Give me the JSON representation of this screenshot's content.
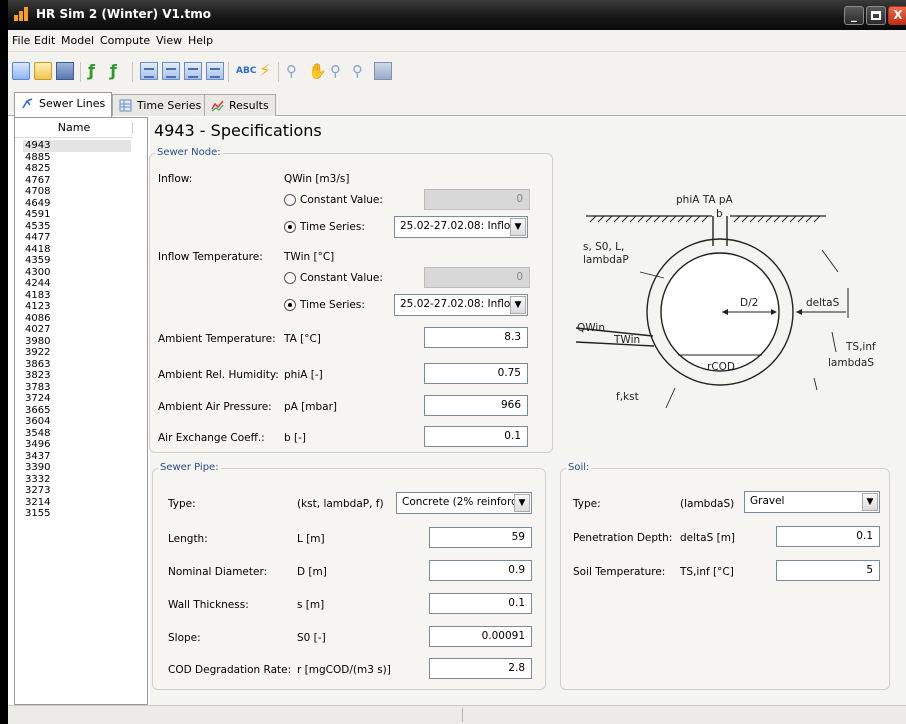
{
  "window": {
    "title": "HR Sim 2 (Winter) V1.tmo",
    "minimize": "_",
    "close": "X"
  },
  "menu": [
    "File",
    "Edit",
    "Model",
    "Compute",
    "View",
    "Help"
  ],
  "tabs": [
    {
      "label": "Sewer Lines",
      "icon": "sewer-lines-icon",
      "active": true
    },
    {
      "label": "Time Series",
      "icon": "table-icon",
      "active": false
    },
    {
      "label": "Results",
      "icon": "chart-icon",
      "active": false
    }
  ],
  "list": {
    "header": "Name",
    "selected": "4943",
    "items": [
      "4943",
      "4885",
      "4825",
      "4767",
      "4708",
      "4649",
      "4591",
      "4535",
      "4477",
      "4418",
      "4359",
      "4300",
      "4244",
      "4183",
      "4123",
      "4086",
      "4027",
      "3980",
      "3922",
      "3863",
      "3823",
      "3783",
      "3724",
      "3665",
      "3604",
      "3548",
      "3496",
      "3437",
      "3390",
      "3332",
      "3273",
      "3214",
      "3155"
    ]
  },
  "heading": "4943 - Specifications",
  "sewer_node": {
    "legend": "Sewer Node:",
    "inflow": {
      "label": "Inflow:",
      "symbol": "QWin [m3/s]",
      "constant_label": "Constant Value:",
      "constant_value": "0",
      "series_label": "Time Series:",
      "series_value": "25.02-27.02.08: Inflo"
    },
    "inflow_temp": {
      "label": "Inflow Temperature:",
      "symbol": "TWin [°C]",
      "constant_label": "Constant Value:",
      "constant_value": "0",
      "series_label": "Time Series:",
      "series_value": "25.02-27.02.08: Inflo"
    },
    "ambient_temp": {
      "label": "Ambient Temperature:",
      "symbol": "TA [°C]",
      "value": "8.3"
    },
    "ambient_hum": {
      "label": "Ambient Rel. Humidity:",
      "symbol": "phiA [-]",
      "value": "0.75"
    },
    "ambient_press": {
      "label": "Ambient Air Pressure:",
      "symbol": "pA [mbar]",
      "value": "966"
    },
    "air_exchange": {
      "label": "Air Exchange Coeff.:",
      "symbol": "b [-]",
      "value": "0.1"
    }
  },
  "sewer_pipe": {
    "legend": "Sewer Pipe:",
    "type": {
      "label": "Type:",
      "symbol": "(kst, lambdaP, f)",
      "value": "Concrete (2% reinforc"
    },
    "length": {
      "label": "Length:",
      "symbol": "L [m]",
      "value": "59"
    },
    "diameter": {
      "label": "Nominal Diameter:",
      "symbol": "D [m]",
      "value": "0.9"
    },
    "wall": {
      "label": "Wall Thickness:",
      "symbol": "s [m]",
      "value": "0.1"
    },
    "slope": {
      "label": "Slope:",
      "symbol": "S0 [-]",
      "value": "0.00091"
    },
    "cod": {
      "label": "COD Degradation Rate:",
      "symbol": "r [mgCOD/(m3 s)]",
      "value": "2.8"
    }
  },
  "soil": {
    "legend": "Soil:",
    "type": {
      "label": "Type:",
      "symbol": "(lambdaS)",
      "value": "Gravel"
    },
    "penetration": {
      "label": "Penetration Depth:",
      "symbol": "deltaS [m]",
      "value": "0.1"
    },
    "temp": {
      "label": "Soil Temperature:",
      "symbol": "TS,inf [°C]",
      "value": "5"
    }
  },
  "diagram": {
    "air": "phiA TA pA",
    "b": "b",
    "pipe": "s, S0, L,",
    "lambdaP": "lambdaP",
    "half_d": "D/2",
    "deltaS": "deltaS",
    "qwin": "QWin",
    "twin": "TWin",
    "rcod": "rCOD",
    "ts": "TS,inf",
    "lambdaS": "lambdaS",
    "fkst": "f,kst"
  }
}
